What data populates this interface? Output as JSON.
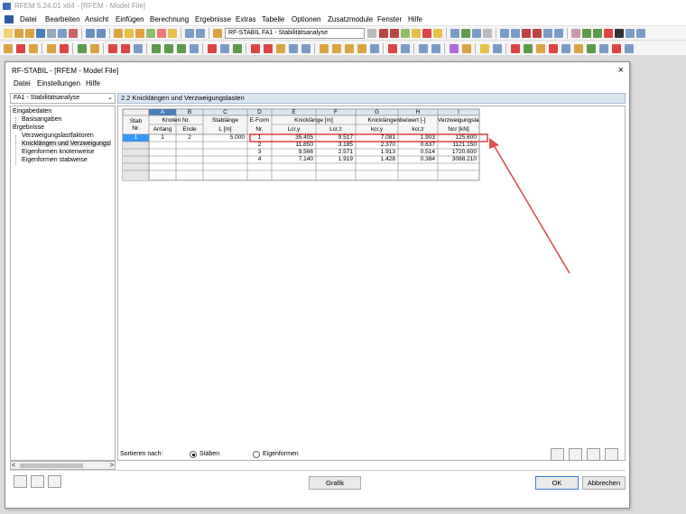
{
  "app_title": "RFEM 5.24.01 x64 - [RFEM - Model File]",
  "menubar": [
    "Datei",
    "Bearbeiten",
    "Ansicht",
    "Einfügen",
    "Berechnung",
    "Ergebnisse",
    "Extras",
    "Tabelle",
    "Optionen",
    "Zusatzmodule",
    "Fenster",
    "Hilfe"
  ],
  "toolbar": {
    "module_combo": "RF-STABIL FA1 - Stabilitätsanalyse"
  },
  "dialog": {
    "title": "RF-STABIL - [RFEM - Model File]",
    "close_icon": "×",
    "menu": [
      "Datei",
      "Einstellungen",
      "Hilfe"
    ],
    "case_combo": "FA1 - Stabilitätsanalyse",
    "section_title": "2.2 Knicklängen und Verzweigungslasten",
    "tree": {
      "group_input": "Eingabedaten",
      "input_items": [
        "Basisangaben"
      ],
      "group_results": "Ergebnisse",
      "result_items": [
        "Verzweigungslastfaktoren",
        "Knicklängen und Verzweigungsl",
        "Eigenformen knotenweise",
        "Eigenformen stabweise"
      ]
    },
    "table": {
      "col_letters": [
        "A",
        "B",
        "C",
        "D",
        "E",
        "F",
        "G",
        "H",
        "I"
      ],
      "stab_header": [
        "Stab",
        "Nr."
      ],
      "group_headers": {
        "knoten": "Knoten Nr.",
        "stablaenge": "Stablänge",
        "eform": "E-Form",
        "knicklaenge": "Knicklänge [m]",
        "beiwert": "Knicklängenbeiwert [-]",
        "verzweigung": "Verzweigungslast"
      },
      "sub_headers": [
        "Anfang",
        "Ende",
        "L [m]",
        "Nr.",
        "Lcr,y",
        "Lcr,z",
        "kcr,y",
        "kcr,z",
        "Ncr [kN]"
      ],
      "rows": [
        {
          "stab": "1",
          "anfang": "1",
          "ende": "2",
          "laenge": "5.000",
          "eform": "1",
          "lcry": "35.405",
          "lcrz": "9.517",
          "kcry": "7.081",
          "kcrz": "1.903",
          "ncr": "125.600"
        },
        {
          "stab": "",
          "anfang": "",
          "ende": "",
          "laenge": "",
          "eform": "2",
          "lcry": "11.850",
          "lcrz": "3.185",
          "kcry": "2.370",
          "kcrz": "0.637",
          "ncr": "1121.150"
        },
        {
          "stab": "",
          "anfang": "",
          "ende": "",
          "laenge": "",
          "eform": "3",
          "lcry": "9.566",
          "lcrz": "2.571",
          "kcry": "1.913",
          "kcrz": "0.514",
          "ncr": "1720.600"
        },
        {
          "stab": "",
          "anfang": "",
          "ende": "",
          "laenge": "",
          "eform": "4",
          "lcry": "7.140",
          "lcrz": "1.919",
          "kcry": "1.428",
          "kcrz": "0.384",
          "ncr": "3088.210"
        }
      ]
    },
    "sort_label": "Sortieren nach:",
    "sort_options": [
      "Stäben",
      "Eigenformen"
    ],
    "sort_selected": "Stäben",
    "buttons": {
      "grafik": "Grafik",
      "ok": "OK",
      "cancel": "Abbrechen"
    },
    "colors": {
      "highlight": "#e03030",
      "arrow": "#e05050",
      "selected_row": "#3399ff",
      "header_bg": "#dce6f1",
      "col_letter_bg": "#4a7ebb"
    }
  }
}
